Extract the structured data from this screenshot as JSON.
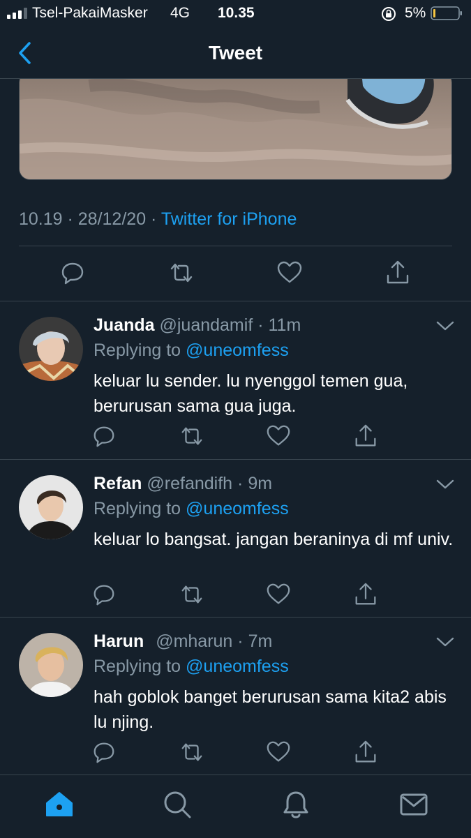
{
  "status_bar": {
    "carrier": "Tsel-PakaiMasker",
    "network": "4G",
    "time": "10.35",
    "battery": "5%"
  },
  "header": {
    "title": "Tweet"
  },
  "tweet": {
    "timestamp": "10.19 · 28/12/20 · ",
    "source": "Twitter for iPhone"
  },
  "replies": [
    {
      "name": "Juanda",
      "handle": "@juandamif",
      "time": "· 11m",
      "replying_prefix": "Replying to ",
      "replying_to": "@uneomfess",
      "text": "keluar lu sender. lu nyenggol temen gua, berurusan sama gua juga."
    },
    {
      "name": "Refan",
      "handle": "@refandifh",
      "time": "· 9m",
      "replying_prefix": "Replying to ",
      "replying_to": "@uneomfess",
      "text": "keluar lo bangsat. jangan beraninya di mf univ."
    },
    {
      "name": "Harun",
      "handle": "@mharun",
      "time": "· 7m",
      "replying_prefix": "Replying to ",
      "replying_to": "@uneomfess",
      "text": "hah goblok banget berurusan sama kita2 abis lu njing."
    }
  ],
  "colors": {
    "background": "#15202b",
    "accent": "#1da1f2",
    "secondary_text": "#8899a6",
    "divider": "#38444d"
  },
  "icons": [
    "back-icon",
    "reply-icon",
    "retweet-icon",
    "like-icon",
    "share-icon",
    "chevron-down-icon",
    "home-icon",
    "search-icon",
    "notifications-icon",
    "messages-icon"
  ]
}
